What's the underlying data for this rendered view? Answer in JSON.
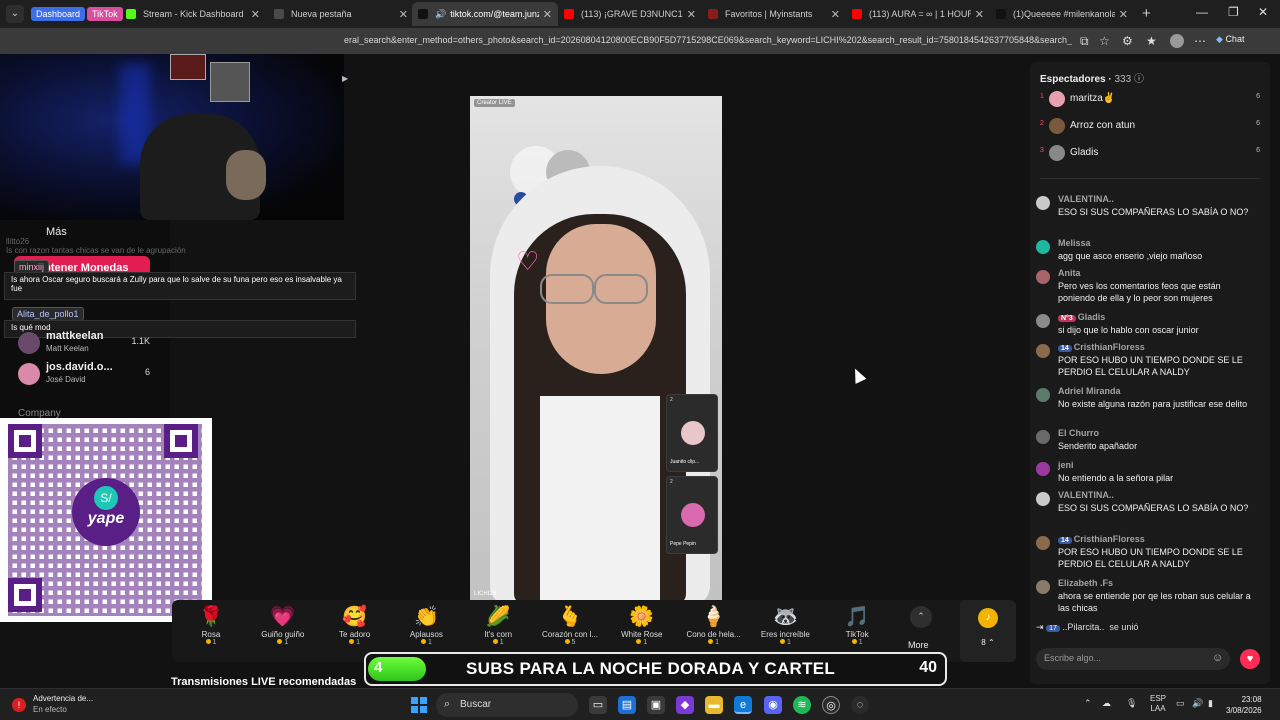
{
  "browser": {
    "tab_groups": [
      {
        "label": "Dashboard",
        "color": "#3b6ee8"
      },
      {
        "label": "TikTok",
        "color": "#d94f9e"
      }
    ],
    "tabs": [
      {
        "title": "Stream - Kick Dashboard",
        "favicon_color": "#53fc18",
        "active": false
      },
      {
        "title": "Nueva pestaña",
        "favicon_color": "#4a4a4a",
        "active": false
      },
      {
        "title": "tiktok.com/@team.junzu",
        "favicon_color": "#111111",
        "active": true
      },
      {
        "title": "(113) ¡GRAVE D3NUNC14 EN",
        "favicon_color": "#ff0000",
        "active": false
      },
      {
        "title": "Favoritos | Myinstants",
        "favicon_color": "#8a1c1c",
        "active": false
      },
      {
        "title": "(113) AURA = ∞ | 1 HOUR VI",
        "favicon_color": "#ff0000",
        "active": false
      },
      {
        "title": "(1)Queeeee #milenkanolasco",
        "favicon_color": "#111111",
        "active": false
      }
    ],
    "url": "eral_search&enter_method=others_photo&search_id=20260804120800ECB90F5D7715298CE069&search_keyword=LICHI%202&search_result_id=7580184542637705848&search_",
    "chat_label": "Chat"
  },
  "stream_overlay": {
    "more_label": "Más",
    "coins_button": "Obtener Monedas",
    "faded_line": "Is con razon tantas chicas se van de le agrupación",
    "faded_name": "llitto26",
    "chat_lines": [
      {
        "user": "minxiij",
        "text": "Is ahora Oscar seguro buscará a Zully para que lo salve de su funa pero eso es insalvable ya fue"
      },
      {
        "user": "Alita_de_pollo1",
        "text": "Is qué mod"
      }
    ],
    "ranking": [
      {
        "name": "mattkeelan",
        "sub": "Matt Keelan",
        "count": "1.1K"
      },
      {
        "name": "jos.david.o...",
        "sub": "José David",
        "count": "6"
      }
    ],
    "company_label": "Company",
    "qr_brand": "yape"
  },
  "video": {
    "creator_tag": "Creator LIVE",
    "watermark": "LICHI28",
    "guests": [
      {
        "name": "Juanito clip...",
        "count": "2"
      },
      {
        "name": "Pepe Pepin",
        "count": "2"
      }
    ]
  },
  "gifts": [
    {
      "icon": "🌹",
      "label": "Rosa",
      "price": "1"
    },
    {
      "icon": "💗",
      "label": "Guiño guiño",
      "price": "1"
    },
    {
      "icon": "🥰",
      "label": "Te adoro",
      "price": "1"
    },
    {
      "icon": "👏",
      "label": "Aplausos",
      "price": "1"
    },
    {
      "icon": "🌽",
      "label": "It's corn",
      "price": "1"
    },
    {
      "icon": "🫰",
      "label": "Corazón con l...",
      "price": "5"
    },
    {
      "icon": "🌼",
      "label": "White Rose",
      "price": "1"
    },
    {
      "icon": "🍦",
      "label": "Cono de hela...",
      "price": "1"
    },
    {
      "icon": "🦝",
      "label": "Eres increíble",
      "price": "1"
    },
    {
      "icon": "🎵",
      "label": "TikTok",
      "price": "1"
    }
  ],
  "gift_more_label": "More",
  "coin_balance": "8",
  "recommended_label": "Transmisiones LIVE recomendadas",
  "subs_banner": {
    "current": "4",
    "text": "SUBS PARA LA NOCHE DORADA Y CARTEL",
    "goal": "40",
    "progress": 0.1
  },
  "viewers": {
    "title": "Espectadores",
    "count": "333",
    "top": [
      {
        "rank": "1",
        "name": "maritza✌",
        "score": "6",
        "color": "#e8a0b0"
      },
      {
        "rank": "2",
        "name": "Arroz con atun",
        "score": "6",
        "color": "#7a5a3a"
      },
      {
        "rank": "3",
        "name": "Gladis",
        "score": "6",
        "color": "#888888"
      }
    ]
  },
  "chat": [
    {
      "name": "VALENTINA..",
      "badge": "",
      "text": "ESO SI SUS COMPAÑERAS LO SABÍA O NO?",
      "color": "#c9c9c9"
    },
    {
      "name": "Melissa",
      "badge": "",
      "text": "agg que asco enserio ,viejo mañoso",
      "color": "#1fb7a0"
    },
    {
      "name": "Anita",
      "badge": "",
      "text": "Pero ves los comentarios feos que están poniendo de ella y lo peor son mujeres",
      "color": "#a8646a"
    },
    {
      "name": "Gladis",
      "badge": "N°3",
      "text": "si dijo que lo hablo con oscar junior",
      "color": "#8a8a8a"
    },
    {
      "name": "CristhianFloress",
      "badge": "14",
      "text": "POR ESO HUBO UN TIEMPO DONDE SE LE PERDIO EL CELULAR A NALDY",
      "color": "#8a6a4a"
    },
    {
      "name": "Adriel Miranda",
      "badge": "",
      "text": "No existe alguna razón para justificar ese delito",
      "color": "#5a7a6a"
    },
    {
      "name": "El Churro",
      "badge": "",
      "text": "Senderito apañador",
      "color": "#6a6a6a"
    },
    {
      "name": "jeni",
      "badge": "",
      "text": "No entiendo a la señora pilar",
      "color": "#9a3aa0"
    },
    {
      "name": "VALENTINA..",
      "badge": "",
      "text": "ESO SI SUS COMPAÑERAS LO SABÍA O NO?",
      "color": "#c9c9c9"
    },
    {
      "name": "CristhianFloress",
      "badge": "14",
      "text": "POR ESO HUBO UN TIEMPO DONDE SE LE PERDIO EL CELULAR A NALDY",
      "color": "#8a6a4a"
    },
    {
      "name": "Elizabeth .Fs",
      "badge": "",
      "text": "ahora se entiende por qe les roban sus celular a las chicas",
      "color": "#8a7a6a"
    }
  ],
  "joined": {
    "badge": "17",
    "name": "..Pilarcita..",
    "text": "se unió"
  },
  "input_placeholder": "Escribe algo...",
  "taskbar": {
    "alert_title": "Advertencia de...",
    "alert_sub": "En efecto",
    "search_placeholder": "Buscar",
    "lang": "ESP",
    "lang_sub": "LAA",
    "time": "23:08",
    "date": "3/08/2026"
  }
}
